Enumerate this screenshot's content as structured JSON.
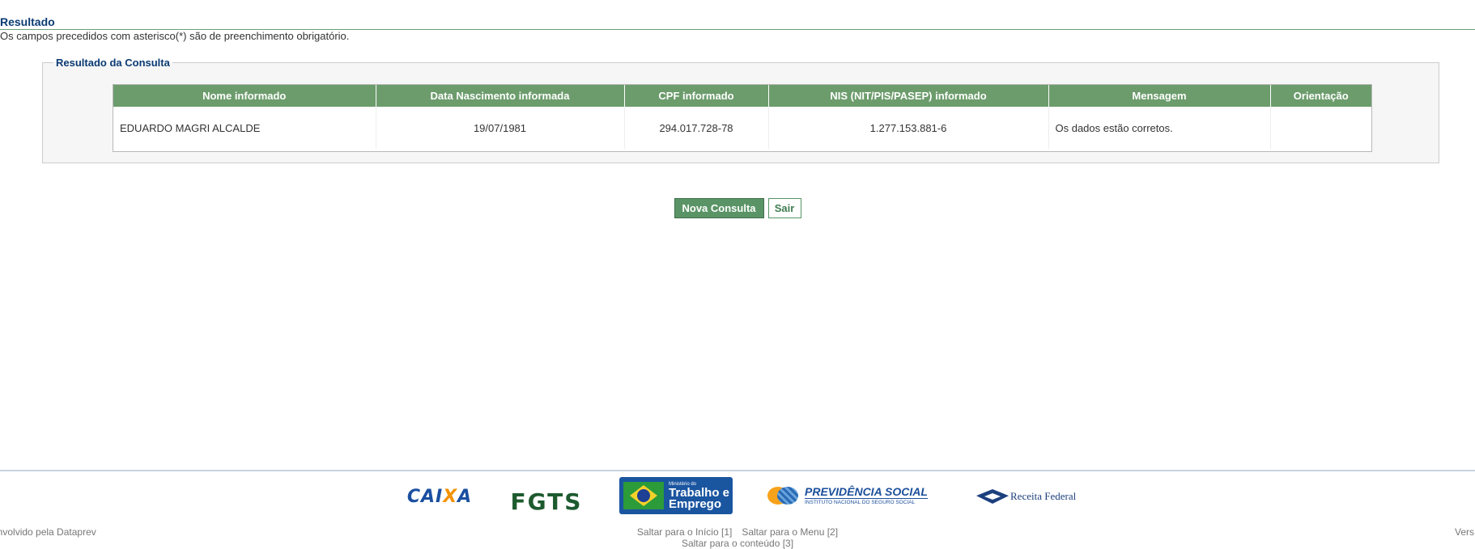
{
  "page": {
    "title": "Resultado",
    "required_note": "Os campos precedidos com asterisco(*) são de preenchimento obrigatório."
  },
  "result_box": {
    "legend": "Resultado da Consulta",
    "columns": [
      "Nome informado",
      "Data Nascimento informada",
      "CPF informado",
      "NIS (NIT/PIS/PASEP) informado",
      "Mensagem",
      "Orientação"
    ],
    "rows": [
      [
        "EDUARDO MAGRI ALCALDE",
        "19/07/1981",
        "294.017.728-78",
        "1.277.153.881-6",
        "Os dados estão corretos.",
        ""
      ]
    ]
  },
  "actions": {
    "new_query_label": "Nova Consulta",
    "exit_label": "Sair"
  },
  "logos": {
    "caixa": "CAIXA",
    "fgts": "FGTS",
    "mte_small": "Ministério do",
    "mte_line1": "Trabalho e",
    "mte_line2": "Emprego",
    "previdencia_title": "PREVIDÊNCIA SOCIAL",
    "previdencia_subtitle": "INSTITUTO NACIONAL DO SEGURO SOCIAL",
    "receita": "Receita Federal"
  },
  "footer": {
    "left_text": "envolvido pela Dataprev",
    "right_text": "Vers",
    "link_inicio": "Saltar para o Início [1]",
    "link_menu": "Saltar para o Menu [2]",
    "link_conteudo": "Saltar para o conteúdo [3]"
  },
  "colors": {
    "title_blue": "#0b3b74",
    "header_green": "#6c9c6c",
    "button_green": "#5a9466"
  }
}
